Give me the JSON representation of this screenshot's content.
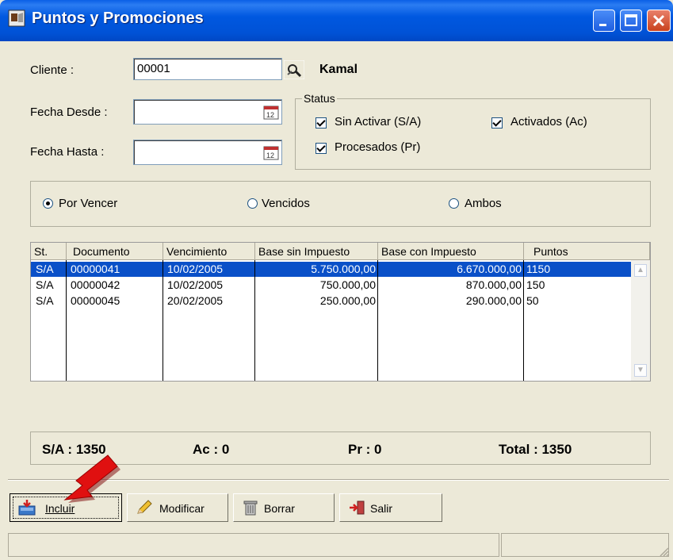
{
  "window": {
    "title": "Puntos y Promociones"
  },
  "form": {
    "cliente_label": "Cliente :",
    "cliente_value": "00001",
    "cliente_name": "Kamal",
    "fecha_desde_label": "Fecha Desde :",
    "fecha_desde_value": "",
    "fecha_hasta_label": "Fecha Hasta :",
    "fecha_hasta_value": ""
  },
  "status": {
    "legend": "Status",
    "sin_activar": "Sin Activar (S/A)",
    "activados": "Activados (Ac)",
    "procesados": "Procesados (Pr)"
  },
  "filter": {
    "por_vencer": "Por Vencer",
    "vencidos": "Vencidos",
    "ambos": "Ambos",
    "selected": "Por Vencer"
  },
  "table": {
    "headers": [
      "St.",
      "Documento",
      "Vencimiento",
      "Base sin Impuesto",
      "Base con Impuesto",
      "Puntos"
    ],
    "rows": [
      [
        "S/A",
        "00000041",
        "10/02/2005",
        "5.750.000,00",
        "6.670.000,00",
        "1150"
      ],
      [
        "S/A",
        "00000042",
        "10/02/2005",
        "750.000,00",
        "870.000,00",
        "150"
      ],
      [
        "S/A",
        "00000045",
        "20/02/2005",
        "250.000,00",
        "290.000,00",
        "50"
      ]
    ]
  },
  "totals": {
    "sa": "S/A : 1350",
    "ac": "Ac : 0",
    "pr": "Pr : 0",
    "total": "Total : 1350"
  },
  "buttons": {
    "incluir": "Incluir",
    "modificar": "Modificar",
    "borrar": "Borrar",
    "salir": "Salir"
  },
  "colors": {
    "selection": "#0a50c8",
    "titlebar": "#0058e0",
    "arrow": "#e01010"
  }
}
